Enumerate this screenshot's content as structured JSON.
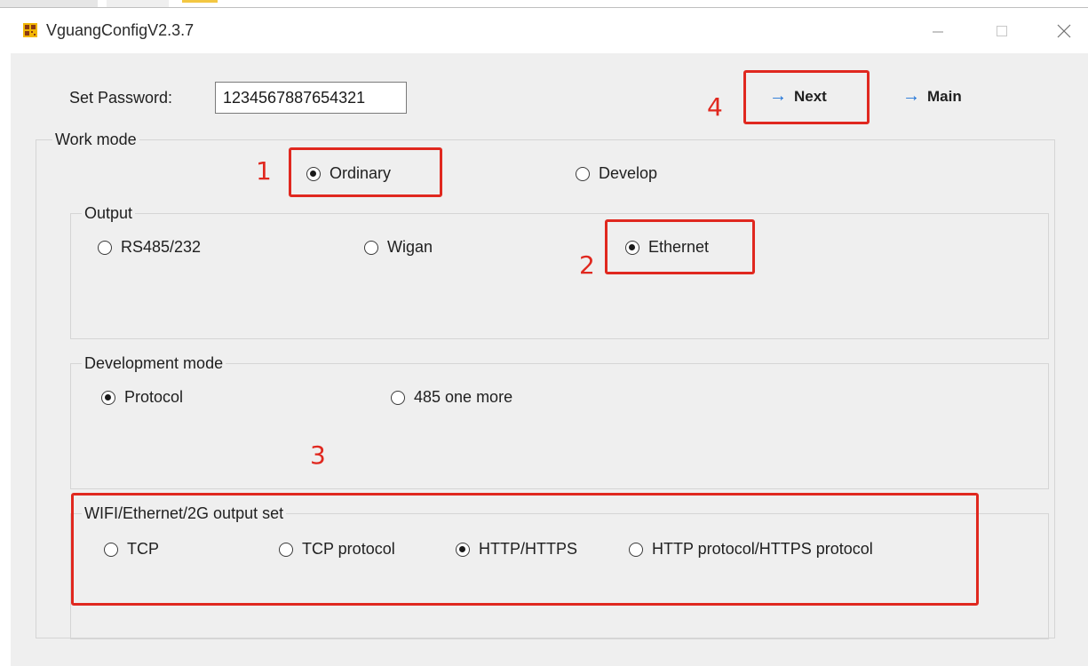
{
  "window": {
    "title": "VguangConfigV2.3.7"
  },
  "password": {
    "label": "Set Password:",
    "value": "1234567887654321"
  },
  "nav": {
    "next": "Next",
    "main": "Main",
    "arrow": "→"
  },
  "work_mode": {
    "title": "Work mode",
    "options": [
      {
        "label": "Ordinary",
        "selected": true
      },
      {
        "label": "Develop",
        "selected": false
      }
    ]
  },
  "output": {
    "title": "Output",
    "options": [
      {
        "label": "RS485/232",
        "selected": false
      },
      {
        "label": "Wigan",
        "selected": false
      },
      {
        "label": "Ethernet",
        "selected": true
      }
    ]
  },
  "development_mode": {
    "title": "Development mode",
    "options": [
      {
        "label": "Protocol",
        "selected": true
      },
      {
        "label": "485 one more",
        "selected": false
      }
    ]
  },
  "network_output": {
    "title": "WIFI/Ethernet/2G output set",
    "options": [
      {
        "label": "TCP",
        "selected": false
      },
      {
        "label": "TCP protocol",
        "selected": false
      },
      {
        "label": "HTTP/HTTPS",
        "selected": true
      },
      {
        "label": "HTTP protocol/HTTPS protocol",
        "selected": false
      }
    ]
  },
  "annotations": {
    "color": "#e0281f",
    "steps": [
      "1",
      "2",
      "3",
      "4"
    ]
  },
  "colors": {
    "accent_arrow": "#1e73d8",
    "background": "#efefef"
  },
  "icons": {
    "app": "qr-code-icon",
    "minimize": "minimize-icon",
    "maximize": "maximize-icon",
    "close": "close-icon"
  }
}
